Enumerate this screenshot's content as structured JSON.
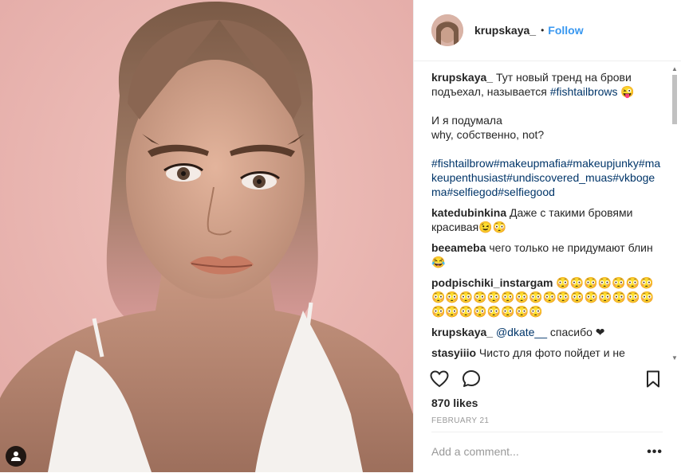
{
  "post": {
    "username": "krupskaya_",
    "follow_label": "Follow",
    "separator": "•"
  },
  "caption": {
    "username": "krupskaya_",
    "text_1": "Тут новый тренд на брови подъехал, называется ",
    "hashtag_1": "#fishtailbrows",
    "emoji_1": "😜",
    "text_2": "И я подумала\nwhy, собственно, not?",
    "tags": "#fishtailbrow#makeupmafia#makeupjunky#makeupenthusiast#undiscovered_muas#vkbogema#selfiegod#selfiegood"
  },
  "comments": [
    {
      "user": "katedubinkina",
      "text": "Даже с такими бровями красивая😉😳"
    },
    {
      "user": "beeameba",
      "text": "чего только не придумают блин 😂"
    },
    {
      "user": "podpischiki_instargam",
      "text": "😳😳😳😳😳😳😳😳😳😳😳😳😳😳😳😳😳😳😳😳😳😳😳😳😳😳😳😳😳😳😳"
    },
    {
      "user": "krupskaya_",
      "mention": "@dkate__",
      "text": " спасибо ❤"
    },
    {
      "user": "stasyiiio",
      "text": "Чисто для фото пойдет и не"
    }
  ],
  "actions": {
    "like_icon": "heart-icon",
    "comment_icon": "comment-bubble-icon",
    "save_icon": "bookmark-icon"
  },
  "likes": "870 likes",
  "date": "FEBRUARY 21",
  "comment_box": {
    "placeholder": "Add a comment...",
    "more": "•••"
  },
  "colors": {
    "link_blue": "#3897f0",
    "hashtag": "#003569",
    "muted": "#999999",
    "divider": "#efefef",
    "photo_background": "#e9b7b1"
  }
}
